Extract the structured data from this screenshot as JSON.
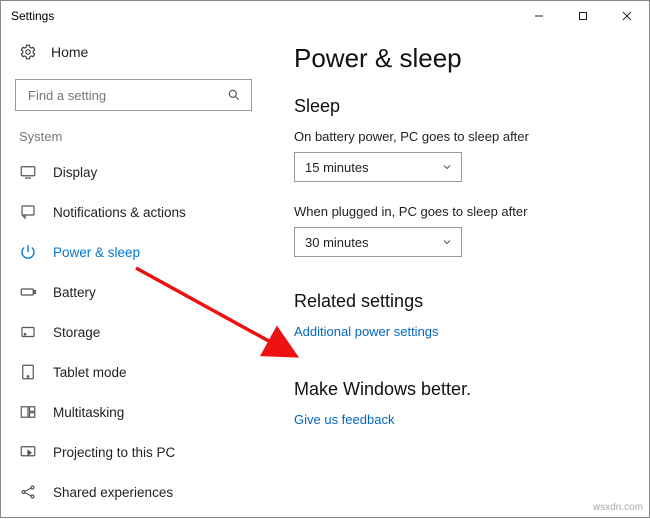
{
  "window": {
    "title": "Settings"
  },
  "home": {
    "label": "Home"
  },
  "search": {
    "placeholder": "Find a setting"
  },
  "group": {
    "label": "System"
  },
  "nav": {
    "items": [
      {
        "key": "display",
        "label": "Display"
      },
      {
        "key": "notifications",
        "label": "Notifications & actions"
      },
      {
        "key": "power-sleep",
        "label": "Power & sleep"
      },
      {
        "key": "battery",
        "label": "Battery"
      },
      {
        "key": "storage",
        "label": "Storage"
      },
      {
        "key": "tablet-mode",
        "label": "Tablet mode"
      },
      {
        "key": "multitasking",
        "label": "Multitasking"
      },
      {
        "key": "projecting",
        "label": "Projecting to this PC"
      },
      {
        "key": "shared",
        "label": "Shared experiences"
      }
    ]
  },
  "page": {
    "title": "Power & sleep",
    "sleep": {
      "heading": "Sleep",
      "battery_label": "On battery power, PC goes to sleep after",
      "battery_value": "15 minutes",
      "plugged_label": "When plugged in, PC goes to sleep after",
      "plugged_value": "30 minutes"
    },
    "related": {
      "heading": "Related settings",
      "link": "Additional power settings"
    },
    "feedback": {
      "heading": "Make Windows better.",
      "link": "Give us feedback"
    }
  },
  "watermark": "wsxdn.com"
}
